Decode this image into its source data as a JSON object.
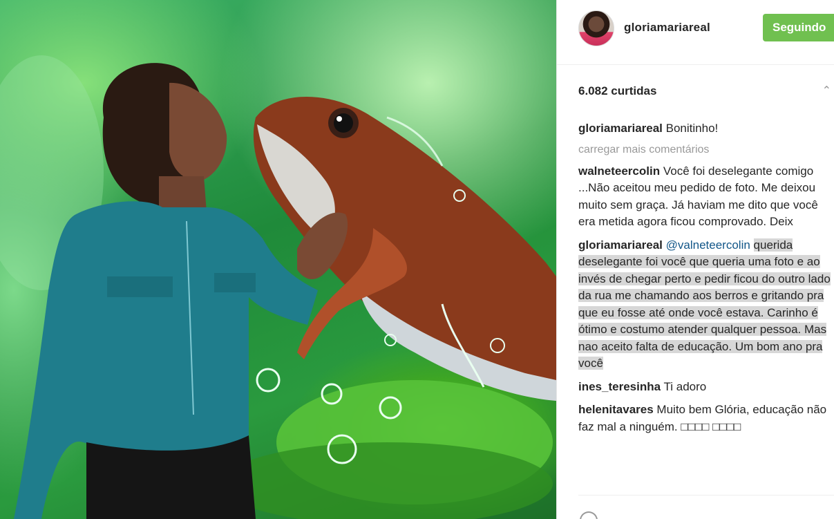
{
  "post": {
    "username": "gloriamariareal",
    "follow_label": "Seguindo",
    "likes_text": "6.082 curtidas"
  },
  "caption": {
    "user": "gloriamariareal",
    "text": "Bonitinho!"
  },
  "load_more_label": "carregar mais comentários",
  "comments": [
    {
      "user": "walneteercolin",
      "text": "Você foi deselegante comigo ...Não aceitou meu pedido de foto. Me deixou muito sem graça. Já haviam me dito que você era metida agora ficou comprovado. Deix"
    },
    {
      "user": "gloriamariareal",
      "mention": "@valneteercolin",
      "text": "querida deselegante foi você que queria uma foto e ao invés de chegar perto e pedir ficou do outro lado da rua me chamando aos berros e gritando pra que eu fosse até onde você estava. Carinho é ótimo e costumo atender qualquer pessoa. Mas nao aceito falta de educação. Um bom ano pra você"
    },
    {
      "user": "ines_teresinha",
      "text": "Ti adoro"
    },
    {
      "user": "helenitavares",
      "text": "Muito bem Glória, educação não faz mal a ninguém. □□□□ □□□□"
    }
  ],
  "icons": {
    "avatar": "profile-photo",
    "chevron": "chevron-up-icon",
    "heart": "heart-icon"
  },
  "colors": {
    "follow_button": "#70c050",
    "highlight": "#d7d7d7",
    "mention": "#125688"
  }
}
